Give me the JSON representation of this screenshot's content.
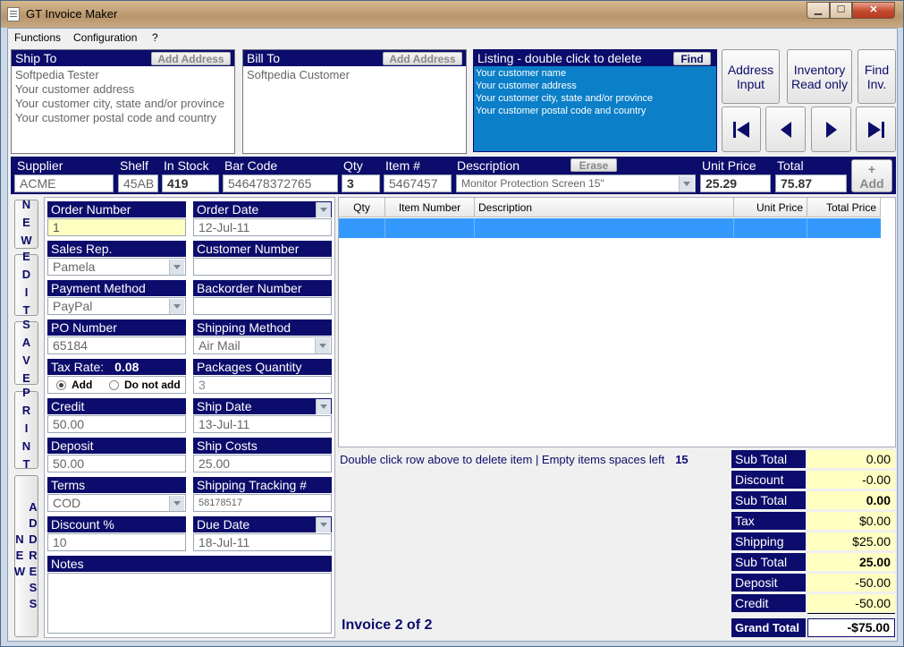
{
  "window": {
    "title": "GT Invoice Maker",
    "min": "▁",
    "max": "☐",
    "close": "✕"
  },
  "menu": {
    "items": [
      "Functions",
      "Configuration",
      "?"
    ]
  },
  "ship_to": {
    "header": "Ship To",
    "add_label": "Add Address",
    "lines": [
      "Softpedia Tester",
      "Your customer address",
      "Your customer city, state and/or province",
      "Your customer postal code and country"
    ]
  },
  "bill_to": {
    "header": "Bill To",
    "add_label": "Add Address",
    "lines": [
      "Softpedia Customer"
    ]
  },
  "listing": {
    "header": "Listing - double click to delete",
    "find_label": "Find",
    "lines": [
      "Your customer name",
      "Your customer address",
      "Your customer city, state and/or province",
      "Your customer postal code and country"
    ]
  },
  "topbuttons": {
    "address_input": "Address\nInput",
    "inventory": "Inventory\nRead only",
    "find_inv": "Find\nInv."
  },
  "item_entry": {
    "labels": {
      "supplier": "Supplier",
      "shelf": "Shelf",
      "in_stock": "In Stock",
      "bar_code": "Bar Code",
      "qty": "Qty",
      "item_no": "Item #",
      "description": "Description",
      "unit_price": "Unit Price",
      "total": "Total"
    },
    "erase_label": "Erase",
    "add_label": "Add",
    "add_plus": "+",
    "values": {
      "supplier": "ACME",
      "shelf": "45AB",
      "in_stock": "419",
      "bar_code": "546478372765",
      "qty": "3",
      "item_no": "5467457",
      "description": "Monitor Protection Screen 15\"",
      "unit_price": "25.29",
      "total": "75.87"
    }
  },
  "side_buttons": {
    "new": "NEW",
    "edit": "EDIT",
    "save": "SAVE",
    "print": "PRINT",
    "new_address": "NEW ADDRESS"
  },
  "form": {
    "order_number": {
      "label": "Order Number",
      "value": "1"
    },
    "order_date": {
      "label": "Order Date",
      "value": "12-Jul-11"
    },
    "sales_rep": {
      "label": "Sales Rep.",
      "value": "Pamela"
    },
    "customer_number": {
      "label": "Customer Number",
      "value": ""
    },
    "payment_method": {
      "label": "Payment Method",
      "value": "PayPal"
    },
    "backorder_number": {
      "label": "Backorder Number",
      "value": ""
    },
    "po_number": {
      "label": "PO Number",
      "value": "65184"
    },
    "shipping_method": {
      "label": "Shipping Method",
      "value": "Air Mail"
    },
    "tax_rate": {
      "label": "Tax Rate:",
      "value": "0.08",
      "opt_add": "Add",
      "opt_noadd": "Do not add"
    },
    "packages_quantity": {
      "label": "Packages Quantity",
      "value": "3"
    },
    "credit": {
      "label": "Credit",
      "value": "50.00"
    },
    "ship_date": {
      "label": "Ship Date",
      "value": "13-Jul-11"
    },
    "deposit": {
      "label": "Deposit",
      "value": "50.00"
    },
    "ship_costs": {
      "label": "Ship Costs",
      "value": "25.00"
    },
    "terms": {
      "label": "Terms",
      "value": "COD"
    },
    "shipping_tracking": {
      "label": "Shipping Tracking  #",
      "value": "58178517"
    },
    "discount_pct": {
      "label": "Discount %",
      "value": "10"
    },
    "due_date": {
      "label": "Due Date",
      "value": "18-Jul-11"
    },
    "notes": {
      "label": "Notes",
      "value": ""
    }
  },
  "grid": {
    "columns": [
      "Qty",
      "Item Number",
      "Description",
      "Unit Price",
      "Total Price"
    ]
  },
  "status": {
    "hint": "Double click row above to delete item  |  Empty items spaces left",
    "spaces_left": "15",
    "invoice": "Invoice 2 of 2"
  },
  "totals": [
    {
      "label": "Sub Total",
      "value": "0.00",
      "bold": false
    },
    {
      "label": "Discount",
      "value": "-0.00",
      "bold": false
    },
    {
      "label": "Sub Total",
      "value": "0.00",
      "bold": true
    },
    {
      "label": "Tax",
      "value": "$0.00",
      "bold": false
    },
    {
      "label": "Shipping",
      "value": "$25.00",
      "bold": false
    },
    {
      "label": "Sub Total",
      "value": "25.00",
      "bold": true
    },
    {
      "label": "Deposit",
      "value": "-50.00",
      "bold": false
    },
    {
      "label": "Credit",
      "value": "-50.00",
      "bold": false
    }
  ],
  "grand_total": {
    "label": "Grand Total",
    "value": "-$75.00"
  },
  "colors": {
    "navy": "#0c0c6c",
    "listing": "#0b7fc8",
    "highlight_row": "#3399ff",
    "total_bg": "#ffffc2"
  }
}
